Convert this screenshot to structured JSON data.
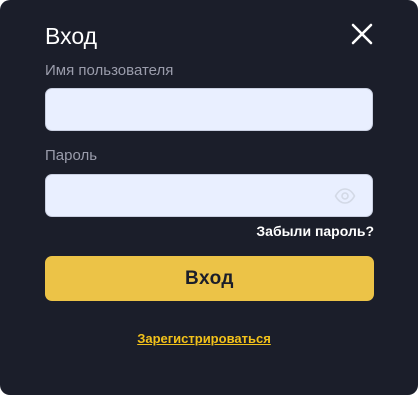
{
  "dialog": {
    "title": "Вход",
    "close_icon": "close-icon"
  },
  "username": {
    "label": "Имя пользователя",
    "value": "",
    "placeholder": ""
  },
  "password": {
    "label": "Пароль",
    "value": "",
    "placeholder": "",
    "toggle_icon": "eye-icon"
  },
  "links": {
    "forgot_password": "Забыли пароль?",
    "register": "Зарегистрироваться"
  },
  "submit": {
    "label": "Вход"
  },
  "colors": {
    "background": "#1b1e2a",
    "input_background": "#e9efff",
    "accent": "#ecc347",
    "link_accent": "#f3c21a",
    "label": "#9a9cab"
  }
}
